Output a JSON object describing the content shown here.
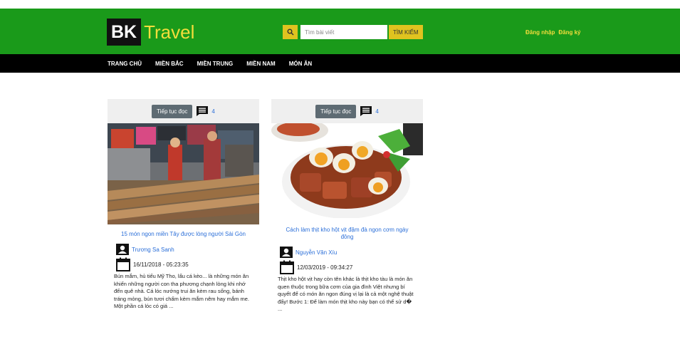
{
  "header": {
    "logo_bk": "BK",
    "logo_travel": "Travel",
    "search_placeholder": "Tìm bài viết",
    "search_button": "TÌM KIẾM",
    "login": "Đăng nhập",
    "register": "Đăng ký"
  },
  "nav": {
    "items": [
      "TRANG CHỦ",
      "MIỀN BẮC",
      "MIỀN TRUNG",
      "MIỀN NAM",
      "MÓN ĂN"
    ]
  },
  "posts": [
    {
      "read_more": "Tiếp tục đọc",
      "comments": "4",
      "title": "15 món ngon miền Tây được lòng người Sài Gòn",
      "author": "Trương Sa Sanh",
      "date": "16/11/2018 - 05:23:35",
      "excerpt": "Bún mắm, hủ tiếu Mỹ Tho, lẩu cá kèo... là những món ăn khiến những người con tha phương chạnh lòng khi nhớ đến quê nhà. Cá lóc nướng trui ăn kèm rau sống, bánh tráng mỏng, bún tươi chấm kèm mắm nêm hay mắm me. Một phần cá lóc có giá ..."
    },
    {
      "read_more": "Tiếp tục đọc",
      "comments": "4",
      "title": "Cách làm thịt kho hột vịt đậm đà ngon cơm ngày đông",
      "author": "Nguyễn Văn Xíu",
      "date": "12/03/2019 - 09:34:27",
      "excerpt": "Thịt kho hột vịt hay còn tên khác là thịt kho tàu là món ăn quen thuộc trong bữa cơm của gia đình Việt nhưng bí quyết để có món ăn ngon đúng vị lại là cả một nghệ thuật đấy! Bước 1: Để làm món thịt kho này bạn có thể sử d� ..."
    }
  ],
  "colors": {
    "header_green": "#1a9a1a",
    "accent_yellow": "#e0c31f",
    "link_blue": "#2a6ed8",
    "nav_black": "#000000"
  }
}
